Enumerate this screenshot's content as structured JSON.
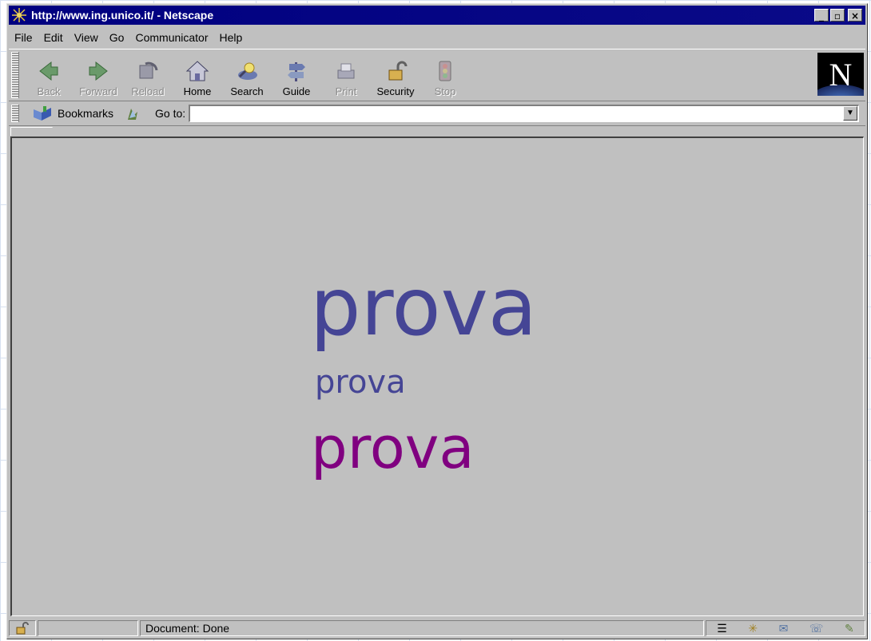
{
  "window": {
    "title": "http://www.ing.unico.it/ - Netscape",
    "controls": [
      "_",
      "▫",
      "×"
    ]
  },
  "menu": {
    "file": "File",
    "edit": "Edit",
    "view": "View",
    "go": "Go",
    "communicator": "Communicator",
    "help": "Help"
  },
  "toolbar": {
    "back": "Back",
    "forward": "Forward",
    "reload": "Reload",
    "home": "Home",
    "search": "Search",
    "guide": "Guide",
    "print": "Print",
    "security": "Security",
    "stop": "Stop"
  },
  "logo": {
    "letter": "N"
  },
  "location": {
    "bookmarks_label": "Bookmarks",
    "goto_label": "Go to:",
    "url": ""
  },
  "page": {
    "line1": "prova",
    "line2": "prova",
    "line3": "prova",
    "colors": {
      "line1": "#454595",
      "line2": "#454595",
      "line3": "#800080"
    }
  },
  "status": {
    "text": "Document: Done"
  }
}
